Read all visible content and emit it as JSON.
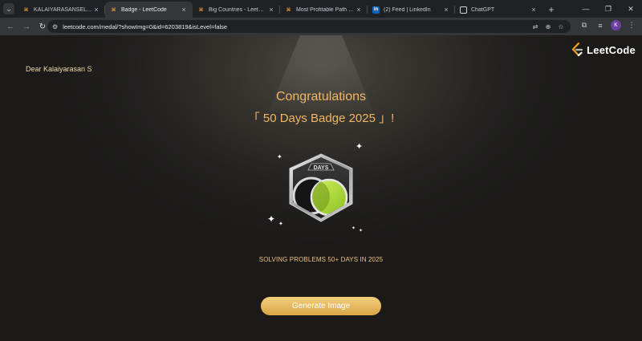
{
  "browser": {
    "tabs": [
      {
        "label": "KALAIYARASANSELVAM - L",
        "favicon": "leetcode-icon",
        "active": false
      },
      {
        "label": "Badge - LeetCode",
        "favicon": "leetcode-icon",
        "active": true
      },
      {
        "label": "Big Countries - LeetCode",
        "favicon": "leetcode-icon",
        "active": false
      },
      {
        "label": "Most Profitable Path in a T",
        "favicon": "leetcode-icon",
        "active": false
      },
      {
        "label": "(2) Feed | LinkedIn",
        "favicon": "linkedin-icon",
        "favicon_text": "in",
        "active": false
      },
      {
        "label": "ChatGPT",
        "favicon": "chatgpt-icon",
        "active": false
      }
    ],
    "close_glyph": "×",
    "new_tab_glyph": "+",
    "address": {
      "url": "leetcode.com/medal/?showImg=0&id=6203819&isLevel=false"
    },
    "profile_initial": "K",
    "accent": "#35363a"
  },
  "page": {
    "greeting": "Dear Kalaiyarasan S",
    "logo_text": "LeetCode",
    "congrats": "Congratulations",
    "badge_title": "「 50 Days Badge 2025 」!",
    "badge_label": "DAYS",
    "subtitle": "SOLVING PROBLEMS 50+ DAYS IN 2025",
    "button_label": "Generate Image",
    "colors": {
      "title": "#f0b766",
      "greeting": "#f3d9a8",
      "button_top": "#f3cf7c",
      "button_bottom": "#d9a446",
      "badge_green": "#a8d43a"
    }
  }
}
